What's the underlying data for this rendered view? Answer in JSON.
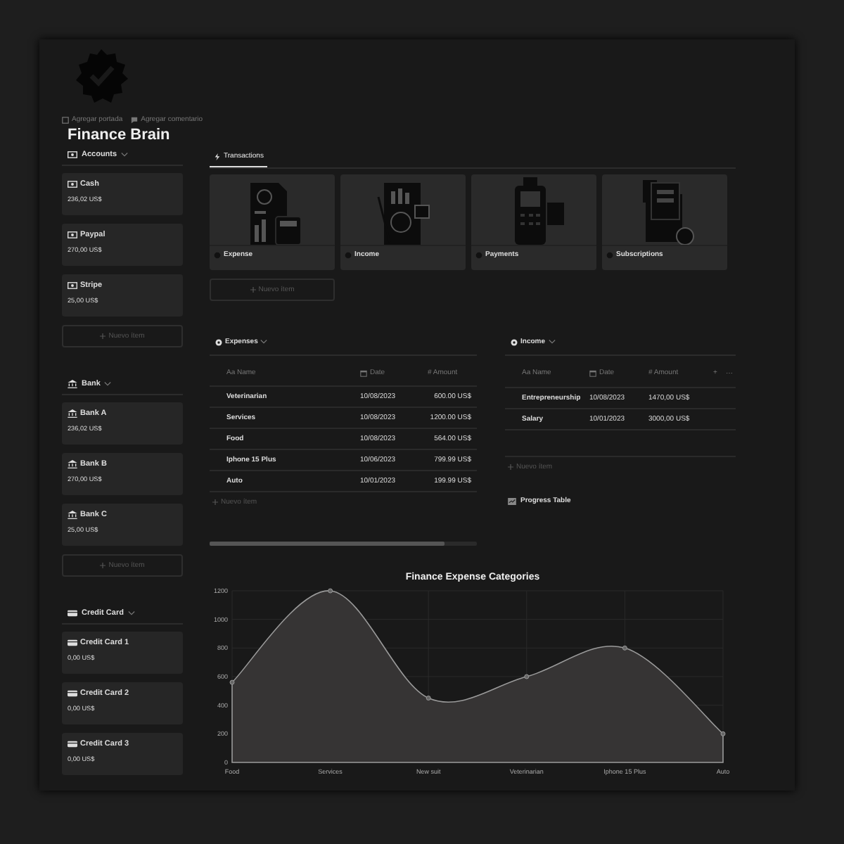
{
  "header": {
    "links": [
      {
        "kind": "cover",
        "label": "Agregar portada"
      },
      {
        "kind": "comment",
        "label": "Agregar comentario"
      }
    ],
    "title": "Finance Brain"
  },
  "sidebar": [
    {
      "title": "Accounts",
      "kind": "cash",
      "cards": [
        {
          "name": "Cash",
          "amount": "236,02 US$"
        },
        {
          "name": "Paypal",
          "amount": "270,00 US$"
        },
        {
          "name": "Stripe",
          "amount": "25,00 US$"
        }
      ],
      "new_item": "Nuevo ítem"
    },
    {
      "title": "Bank",
      "kind": "bank",
      "cards": [
        {
          "name": "Bank A",
          "amount": "236,02 US$"
        },
        {
          "name": "Bank B",
          "amount": "270,00 US$"
        },
        {
          "name": "Bank C",
          "amount": "25,00 US$"
        }
      ],
      "new_item": "Nuevo ítem"
    },
    {
      "title": "Credit Card",
      "kind": "card",
      "cards": [
        {
          "name": "Credit Card 1",
          "amount": "0,00 US$"
        },
        {
          "name": "Credit Card 2",
          "amount": "0,00 US$"
        },
        {
          "name": "Credit Card 3",
          "amount": "0,00 US$"
        }
      ]
    }
  ],
  "tabs": [
    {
      "label": "Transactions",
      "selected": true
    }
  ],
  "gallery": {
    "cards": [
      {
        "kind": "expense",
        "label": "Expense"
      },
      {
        "kind": "income",
        "label": "Income"
      },
      {
        "kind": "payments",
        "label": "Payments"
      },
      {
        "kind": "subscriptions",
        "label": "Subscriptions"
      }
    ],
    "new_item": "Nuevo ítem"
  },
  "expenses": {
    "title": "Expenses",
    "columns": [
      {
        "kind": "text",
        "label": "Aa Name"
      },
      {
        "kind": "date",
        "label": "Date"
      },
      {
        "kind": "number",
        "label": "# Amount"
      }
    ],
    "rows": [
      [
        "Veterinarian",
        "10/08/2023",
        "600.00 US$"
      ],
      [
        "Services",
        "10/08/2023",
        "1200.00 US$"
      ],
      [
        "Food",
        "10/08/2023",
        "564.00 US$"
      ],
      [
        "Iphone 15 Plus",
        "10/06/2023",
        "799.99 US$"
      ],
      [
        "Auto",
        "10/01/2023",
        "199.99 US$"
      ]
    ],
    "new_item": "Nuevo ítem"
  },
  "income": {
    "title": "Income",
    "columns": [
      {
        "kind": "text",
        "label": "Aa Name"
      },
      {
        "kind": "date",
        "label": "Date"
      },
      {
        "kind": "number",
        "label": "# Amount"
      }
    ],
    "header_actions": [
      "+",
      "⋯"
    ],
    "rows": [
      [
        "Entrepreneurship",
        "10/08/2023",
        "1470,00 US$"
      ],
      [
        "Salary",
        "10/01/2023",
        "3000,00 US$"
      ]
    ],
    "new_item": "Nuevo ítem",
    "link": "Progress Table"
  },
  "chart": {
    "chart_data": {
      "type": "area",
      "title": "Finance Expense Categories",
      "categories": [
        "Food",
        "Services",
        "New suit",
        "Veterinarian",
        "Iphone 15 Plus",
        "Auto"
      ],
      "series": [
        {
          "color": "#9a9a9a",
          "values": [
            560,
            1200,
            450,
            600,
            800,
            200
          ]
        }
      ],
      "grid": true,
      "ylim": [
        0,
        1200
      ],
      "yticks": [
        0,
        200,
        400,
        600,
        800,
        1000,
        1200
      ]
    }
  }
}
